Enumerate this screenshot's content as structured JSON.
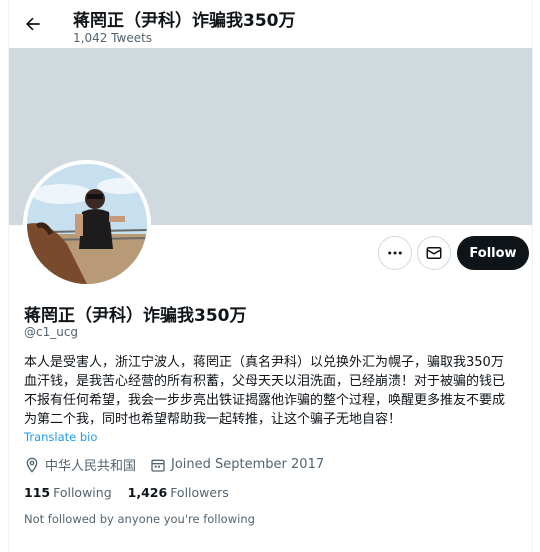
{
  "header": {
    "title": "蒋罔正（尹科）诈骗我350万",
    "tweet_count": "1,042 Tweets"
  },
  "profile": {
    "name": "蒋罔正（尹科）诈骗我350万",
    "handle": "@c1_ucg",
    "bio_lines": [
      "本人是受害人，浙江宁波人，蒋罔正（真名尹科）以兑换外汇为幌子，骗取我350万",
      "血汗钱，是我苦心经营的所有积蓄，父母天天以泪洗面，已经崩溃！对于被骗的钱已",
      "不报有任何希望，我会一步步亮出铁证揭露他诈骗的整个过程，唤醒更多推友不要成",
      "为第二个我，同时也希望帮助我一起转推，让这个骗子无地自容！"
    ],
    "translate_label": "Translate bio",
    "location": "中华人民共和国",
    "joined": "Joined September 2017",
    "following_count": "115",
    "following_label": "Following",
    "followers_count": "1,426",
    "followers_label": "Followers",
    "not_followed_text": "Not followed by anyone you're following"
  },
  "actions": {
    "follow_label": "Follow",
    "more_icon": "more-icon",
    "message_icon": "envelope-icon"
  },
  "colors": {
    "accent": "#1d9bf0",
    "banner": "#cfd9de",
    "button_dark": "#0f1419",
    "muted_text": "#536471"
  }
}
